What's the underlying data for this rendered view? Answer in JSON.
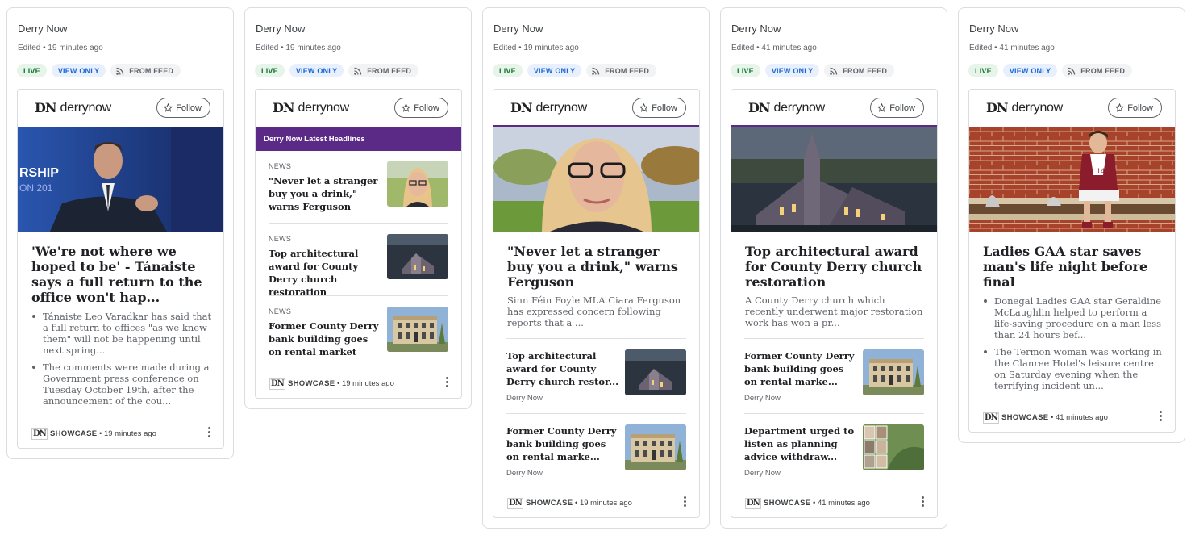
{
  "cards": [
    {
      "publisher": "Derry Now",
      "edited": "Edited • 19 minutes ago",
      "chips": {
        "live": "LIVE",
        "view_only": "VIEW ONLY",
        "from_feed": "FROM FEED"
      },
      "brand": {
        "mark": "DN",
        "name": "derrynow",
        "follow": "Follow"
      },
      "headline": "'We're not where we hoped to be' - Tánaiste says a full return to the office won't hap...",
      "bullets": [
        "Tánaiste Leo Varadkar has said that a full return to offices \"as we knew them\" will not be happening until next spring...",
        "The comments were made during a Government press conference on Tuesday October 19th, after the announcement of the cou..."
      ],
      "footer": {
        "label": "SHOWCASE",
        "time": " • 19 minutes ago"
      }
    },
    {
      "publisher": "Derry Now",
      "edited": "Edited • 19 minutes ago",
      "chips": {
        "live": "LIVE",
        "view_only": "VIEW ONLY",
        "from_feed": "FROM FEED"
      },
      "brand": {
        "mark": "DN",
        "name": "derrynow",
        "follow": "Follow"
      },
      "section_title": "Derry Now Latest Headlines",
      "items": [
        {
          "tag": "NEWS",
          "title": "\"Never let a stranger buy you a drink,\" warns Ferguson"
        },
        {
          "tag": "NEWS",
          "title": "Top architectural award for County Derry church restoration"
        },
        {
          "tag": "NEWS",
          "title": "Former County Derry bank building goes on rental market"
        }
      ],
      "footer": {
        "label": "SHOWCASE",
        "time": " • 19 minutes ago"
      }
    },
    {
      "publisher": "Derry Now",
      "edited": "Edited • 19 minutes ago",
      "chips": {
        "live": "LIVE",
        "view_only": "VIEW ONLY",
        "from_feed": "FROM FEED"
      },
      "brand": {
        "mark": "DN",
        "name": "derrynow",
        "follow": "Follow"
      },
      "headline": "\"Never let a stranger buy you a drink,\" warns Ferguson",
      "summary": "Sinn Féin Foyle MLA Ciara Ferguson has expressed concern following reports that a ...",
      "related": [
        {
          "title": "Top architectural award for County Derry church restor...",
          "source": "Derry Now"
        },
        {
          "title": "Former County Derry bank building goes on rental marke...",
          "source": "Derry Now"
        }
      ],
      "footer": {
        "label": "SHOWCASE",
        "time": " • 19 minutes ago"
      }
    },
    {
      "publisher": "Derry Now",
      "edited": "Edited • 41 minutes ago",
      "chips": {
        "live": "LIVE",
        "view_only": "VIEW ONLY",
        "from_feed": "FROM FEED"
      },
      "brand": {
        "mark": "DN",
        "name": "derrynow",
        "follow": "Follow"
      },
      "headline": "Top architectural award for County Derry church restoration",
      "summary": "A County Derry church which recently underwent major restoration work has won a pr...",
      "related": [
        {
          "title": "Former County Derry bank building goes on rental marke...",
          "source": "Derry Now"
        },
        {
          "title": "Department urged to listen as planning advice withdraw...",
          "source": "Derry Now"
        }
      ],
      "footer": {
        "label": "SHOWCASE",
        "time": " • 41 minutes ago"
      }
    },
    {
      "publisher": "Derry Now",
      "edited": "Edited • 41 minutes ago",
      "chips": {
        "live": "LIVE",
        "view_only": "VIEW ONLY",
        "from_feed": "FROM FEED"
      },
      "brand": {
        "mark": "DN",
        "name": "derrynow",
        "follow": "Follow"
      },
      "headline": "Ladies GAA star saves man's life night before final",
      "bullets": [
        "Donegal Ladies GAA star Geraldine McLaughlin helped to perform a life-saving procedure on a man less than 24 hours bef...",
        "The Termon woman was working in the Clanree Hotel's leisure centre on Saturday evening when the terrifying incident un..."
      ],
      "footer": {
        "label": "SHOWCASE",
        "time": " • 41 minutes ago"
      }
    }
  ],
  "icons": {
    "feed": "rss-feed-icon",
    "follow": "star-outline-icon",
    "more": "more-vert-icon"
  },
  "colors": {
    "brand_purple": "#5b2a86",
    "live_green": "#137333",
    "view_blue": "#1967d2"
  }
}
